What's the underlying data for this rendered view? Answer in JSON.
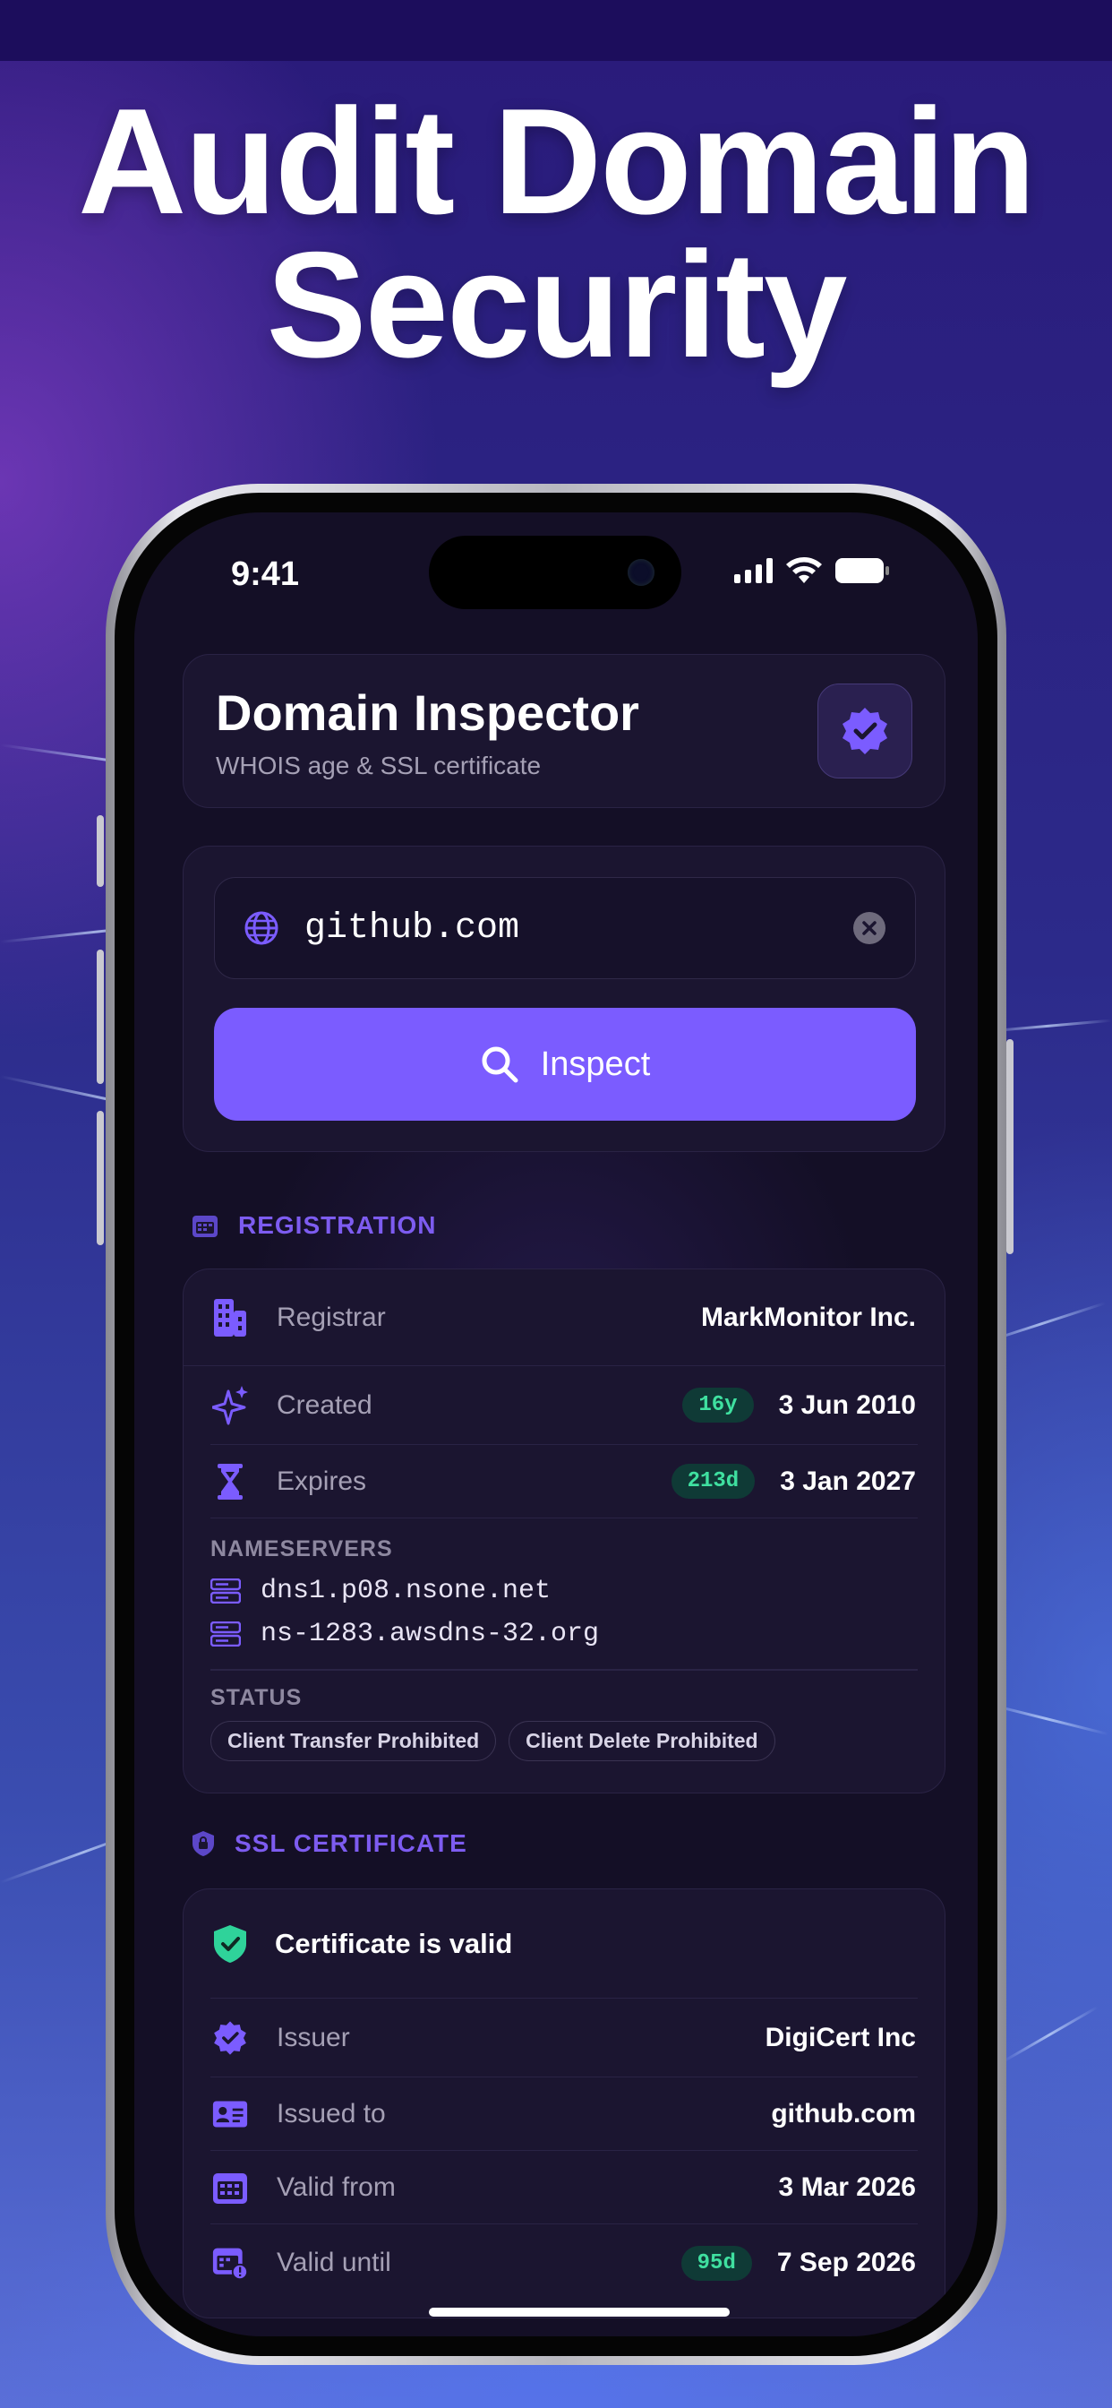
{
  "headline": {
    "line1": "Audit Domain",
    "line2": "Security"
  },
  "status_bar": {
    "time": "9:41"
  },
  "app": {
    "title": "Domain Inspector",
    "subtitle": "WHOIS age & SSL certificate",
    "badge_icon": "verified-badge-icon"
  },
  "search": {
    "value": "github.com",
    "globe_icon": "globe-icon",
    "clear_icon": "clear-icon",
    "button_label": "Inspect"
  },
  "registration": {
    "section_title": "REGISTRATION",
    "rows": [
      {
        "label": "Registrar",
        "value": "MarkMonitor Inc.",
        "icon": "building-icon"
      },
      {
        "label": "Created",
        "badge": "16y",
        "value": "3 Jun 2010",
        "icon": "sparkle-icon"
      },
      {
        "label": "Expires",
        "badge": "213d",
        "value": "3 Jan 2027",
        "icon": "hourglass-icon"
      }
    ],
    "nameservers_title": "NAMESERVERS",
    "nameservers": [
      "dns1.p08.nsone.net",
      "ns-1283.awsdns-32.org"
    ],
    "status_title": "STATUS",
    "status_chips": [
      "Client Transfer Prohibited",
      "Client Delete Prohibited"
    ]
  },
  "ssl": {
    "section_title": "SSL CERTIFICATE",
    "valid_text": "Certificate is valid",
    "rows": [
      {
        "label": "Issuer",
        "value": "DigiCert Inc",
        "icon": "verified-badge-icon"
      },
      {
        "label": "Issued to",
        "value": "github.com",
        "icon": "id-card-icon"
      },
      {
        "label": "Valid from",
        "value": "3 Mar 2026",
        "icon": "calendar-icon"
      },
      {
        "label": "Valid until",
        "badge": "95d",
        "value": "7 Sep 2026",
        "icon": "calendar-alert-icon"
      }
    ]
  },
  "colors": {
    "accent": "#7b5cff",
    "badge_text": "#3fe0a0",
    "background": "#140f26"
  }
}
